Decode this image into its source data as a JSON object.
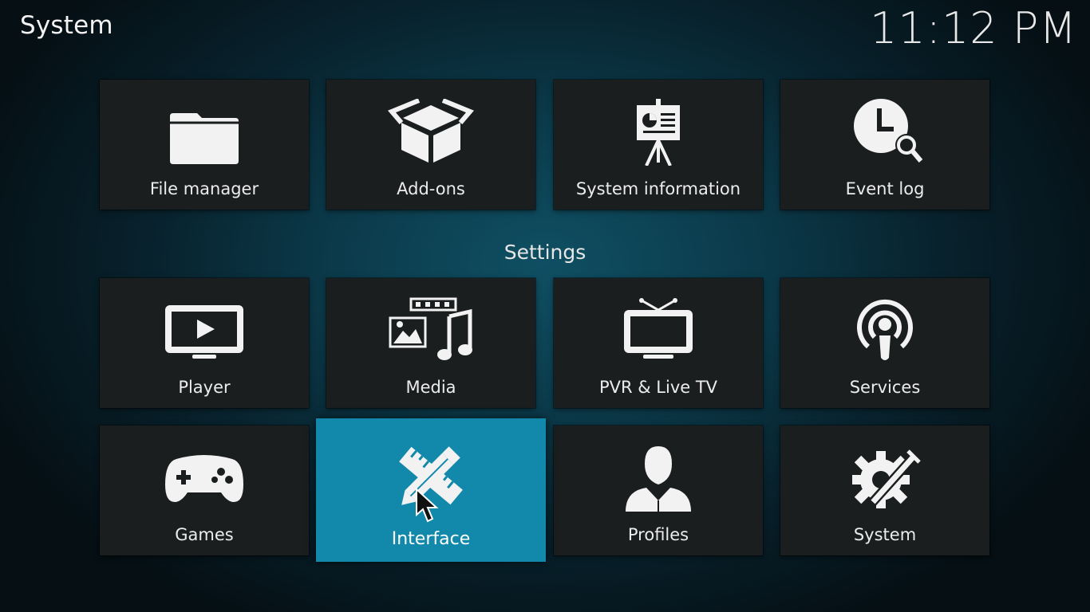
{
  "header": {
    "title": "System",
    "clock": "11:12 PM"
  },
  "top_row": [
    {
      "label": "File manager",
      "icon": "folder-icon"
    },
    {
      "label": "Add-ons",
      "icon": "box-icon"
    },
    {
      "label": "System information",
      "icon": "presentation-board-icon"
    },
    {
      "label": "Event log",
      "icon": "clock-search-icon"
    }
  ],
  "settings": {
    "heading": "Settings",
    "items": [
      {
        "label": "Player",
        "icon": "tv-play-icon"
      },
      {
        "label": "Media",
        "icon": "media-icon"
      },
      {
        "label": "PVR & Live TV",
        "icon": "tv-antenna-icon"
      },
      {
        "label": "Services",
        "icon": "podcast-icon"
      },
      {
        "label": "Games",
        "icon": "gamepad-icon"
      },
      {
        "label": "Interface",
        "icon": "pencil-ruler-icon",
        "focused": true
      },
      {
        "label": "Profiles",
        "icon": "person-icon"
      },
      {
        "label": "System",
        "icon": "gear-wrench-icon"
      }
    ]
  },
  "colors": {
    "tile_background": "#1b1e1f",
    "focus_accent": "#1289ab"
  }
}
